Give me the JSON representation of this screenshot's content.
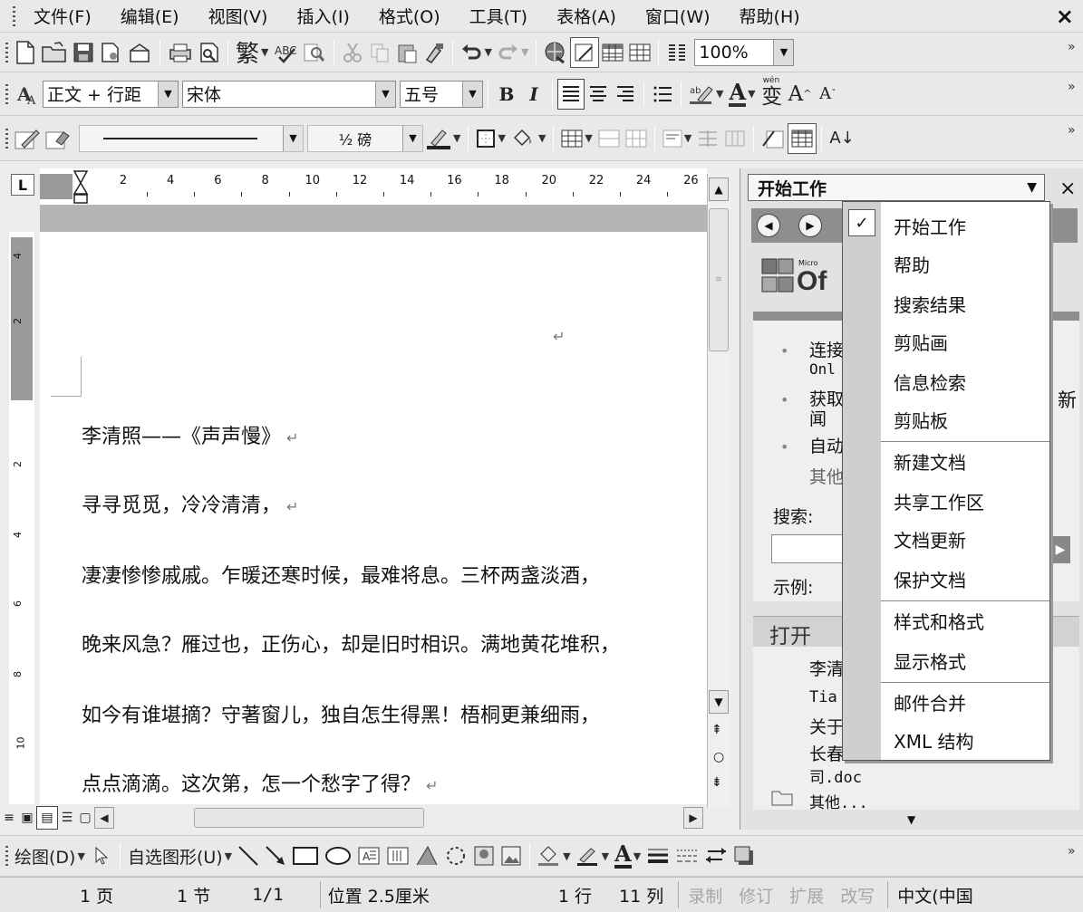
{
  "menubar": {
    "items": [
      "文件(F)",
      "编辑(E)",
      "视图(V)",
      "插入(I)",
      "格式(O)",
      "工具(T)",
      "表格(A)",
      "窗口(W)",
      "帮助(H)"
    ],
    "close_glyph": "×"
  },
  "standard_toolbar": {
    "traditional_chinese": "繁",
    "zoom": "100%"
  },
  "format_toolbar": {
    "style": "正文 + 行距",
    "font": "宋体",
    "size": "五号",
    "bold": "B",
    "italic": "I",
    "font_color_glyph": "A",
    "phonetic": "变",
    "grow": "A",
    "shrink": "A"
  },
  "tables_toolbar": {
    "line_weight": "½ 磅",
    "sort_glyph": "A↓"
  },
  "ruler": {
    "tab_glyph": "L",
    "ticks": [
      "2",
      "4",
      "6",
      "8",
      "10",
      "12",
      "14",
      "16",
      "18",
      "20",
      "22",
      "24",
      "26"
    ]
  },
  "vertical_ruler": {
    "ticks": [
      "4",
      "2",
      "2",
      "4",
      "6",
      "8",
      "10"
    ]
  },
  "document": {
    "lines": [
      "李清照——《声声慢》",
      "寻寻觅觅，冷冷清清，",
      "凄凄惨惨戚戚。乍暖还寒时候，最难将息。三杯两盏淡酒，",
      "晚来风急？雁过也，正伤心，却是旧时相识。满地黄花堆积，",
      "如今有谁堪摘？守著窗儿，独自怎生得黑！梧桐更兼细雨，",
      "点点滴滴。这次第，怎一个愁字了得？"
    ],
    "para_mark": "↵"
  },
  "task_pane": {
    "title": "开始工作",
    "close_glyph": "×",
    "logo_small": "Micro",
    "logo_big": "Of",
    "bullets": [
      "连接",
      "Onl",
      "获取",
      "闻",
      "自动",
      "其他"
    ],
    "right_fragment": "新",
    "search_label": "搜索:",
    "example_label": "示例:",
    "open_header": "打开",
    "open_items": [
      "李清",
      "Tia",
      "关于",
      "长春",
      "司.doc"
    ],
    "other_label": "其他..."
  },
  "dropdown_menu": {
    "checked_glyph": "✓",
    "items": [
      "开始工作",
      "帮助",
      "搜索结果",
      "剪贴画",
      "信息检索",
      "剪贴板",
      "新建文档",
      "共享工作区",
      "文档更新",
      "保护文档",
      "样式和格式",
      "显示格式",
      "邮件合并",
      "XML 结构"
    ]
  },
  "drawing_toolbar": {
    "draw_label": "绘图(D)",
    "autoshapes_label": "自选图形(U)"
  },
  "statusbar": {
    "page": "1 页",
    "section": "1 节",
    "page_of": "1/1",
    "position": "位置 2.5厘米",
    "line": "1 行",
    "column": "11 列",
    "rec": "录制",
    "trk": "修订",
    "ext": "扩展",
    "ovr": "改写",
    "language": "中文(中国"
  }
}
